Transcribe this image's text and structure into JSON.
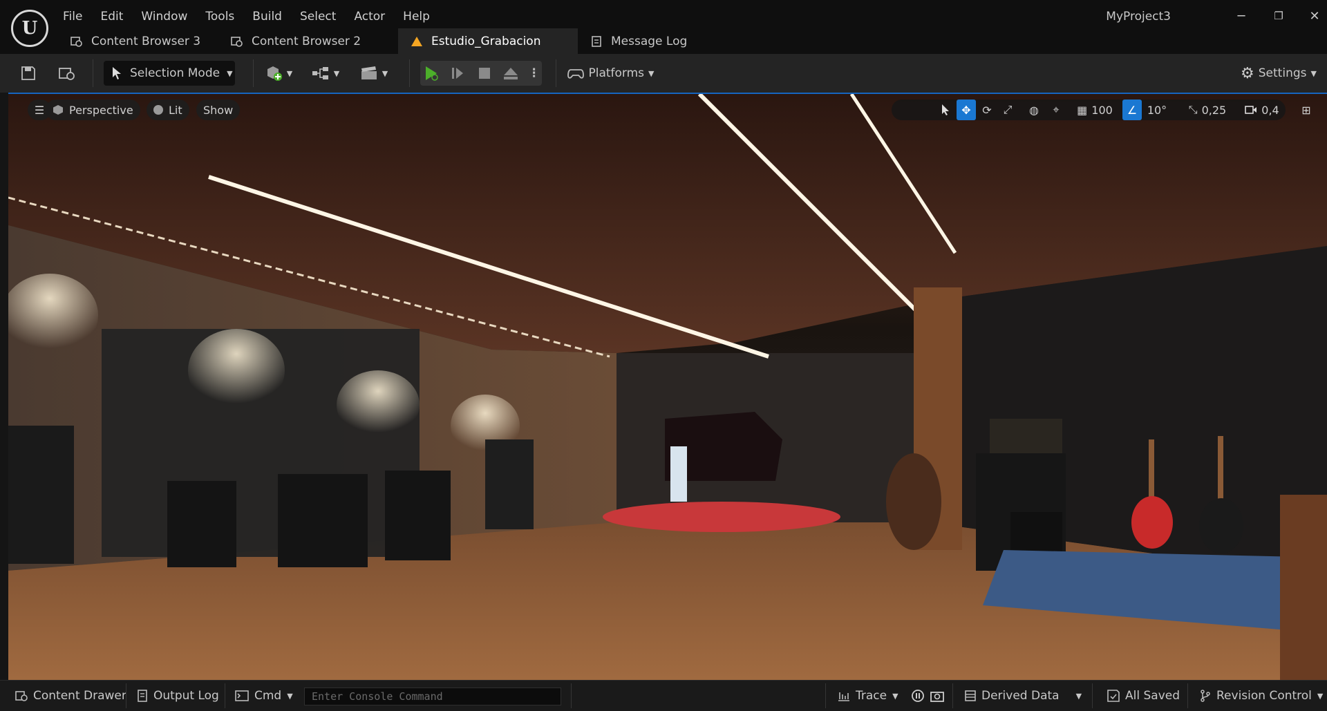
{
  "app": {
    "logo_letter": "U",
    "project_name": "MyProject3",
    "window_controls": {
      "minimize": "─",
      "restore": "❐",
      "close": "✕"
    }
  },
  "menu": [
    "File",
    "Edit",
    "Window",
    "Tools",
    "Build",
    "Select",
    "Actor",
    "Help"
  ],
  "tabs": [
    {
      "label": "Content Browser 3",
      "icon": "content-browser-icon",
      "active": false
    },
    {
      "label": "Content Browser 2",
      "icon": "content-browser-icon",
      "active": false
    },
    {
      "label": "Estudio_Grabacion",
      "icon": "level-icon",
      "active": true
    },
    {
      "label": "Message Log",
      "icon": "message-log-icon",
      "active": false
    }
  ],
  "toolbar": {
    "selection_mode": "Selection Mode",
    "platforms": "Platforms",
    "settings": "Settings"
  },
  "viewport": {
    "view_mode": "Perspective",
    "lighting": "Lit",
    "show": "Show",
    "grid_snap": "100",
    "rotation_snap": "10°",
    "scale_snap": "0,25",
    "camera_speed": "0,4"
  },
  "statusbar": {
    "content_drawer": "Content Drawer",
    "output_log": "Output Log",
    "cmd": "Cmd",
    "console_placeholder": "Enter Console Command",
    "trace": "Trace",
    "derived_data": "Derived Data",
    "all_saved": "All Saved",
    "revision_control": "Revision Control"
  },
  "colors": {
    "accent": "#1a78d2",
    "play_green": "#4caf2a",
    "level_icon": "#f5a623",
    "background": "#151515",
    "panel": "#242424"
  }
}
